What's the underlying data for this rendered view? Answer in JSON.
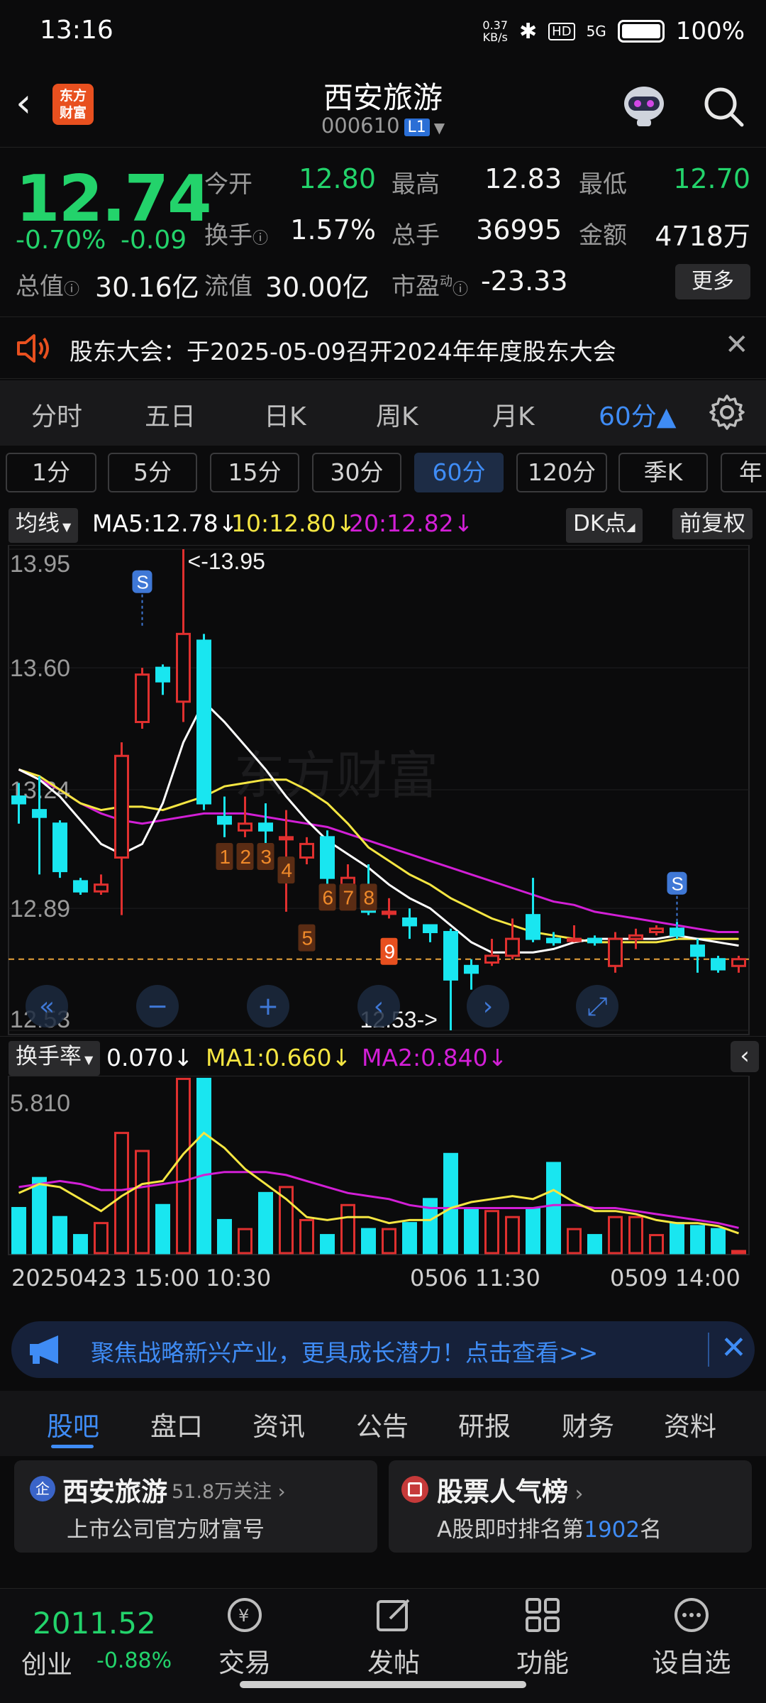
{
  "status_bar": {
    "time": "13:16",
    "net_speed_top": "0.37",
    "net_speed_bottom": "KB/s",
    "signal_label": "5G",
    "hd_label": "HD",
    "battery": "100%"
  },
  "header": {
    "app_logo_line1": "东方",
    "app_logo_line2": "财富",
    "title": "西安旅游",
    "code": "000610",
    "level": "L1"
  },
  "quote": {
    "price": "12.74",
    "pct_change": "-0.70%",
    "abs_change": "-0.09",
    "open_label": "今开",
    "open": "12.80",
    "high_label": "最高",
    "high": "12.83",
    "low_label": "最低",
    "low": "12.70",
    "turnover_label": "换手",
    "turnover": "1.57%",
    "volume_label": "总手",
    "volume": "36995",
    "amount_label": "金额",
    "amount": "4718万",
    "mktcap_label": "总值",
    "mktcap": "30.16亿",
    "float_label": "流值",
    "float_cap": "30.00亿",
    "pe_label": "市盈",
    "pe_sup": "动",
    "pe": "-23.33",
    "more": "更多"
  },
  "notice": {
    "text": "股东大会：于2025-05-09召开2024年年度股东大会"
  },
  "period_tabs": [
    {
      "label": "分时",
      "active": false
    },
    {
      "label": "五日",
      "active": false
    },
    {
      "label": "日K",
      "active": false
    },
    {
      "label": "周K",
      "active": false
    },
    {
      "label": "月K",
      "active": false
    },
    {
      "label": "60分▲",
      "active": true
    }
  ],
  "sub_periods": [
    {
      "label": "1分",
      "active": false
    },
    {
      "label": "5分",
      "active": false
    },
    {
      "label": "15分",
      "active": false
    },
    {
      "label": "30分",
      "active": false
    },
    {
      "label": "60分",
      "active": true
    },
    {
      "label": "120分",
      "active": false
    },
    {
      "label": "季K",
      "active": false
    },
    {
      "label": "年",
      "active": false
    }
  ],
  "ma_row": {
    "selector": "均线",
    "ma5": "MA5:12.78↓",
    "ma10": "10:12.80↓",
    "ma20": "20:12.82↓",
    "dk": "DK点",
    "adjust": "前复权"
  },
  "kline": {
    "y_labels": [
      "13.95",
      "13.60",
      "13.24",
      "12.89",
      "12.53"
    ],
    "high_marker": "<-13.95",
    "low_marker": "12.53->",
    "signal_s": "S",
    "watermark": "东方财富",
    "td_counts": [
      "1",
      "2",
      "3",
      "4",
      "5",
      "6",
      "7",
      "8",
      "9"
    ],
    "colors": {
      "up": "#e0302f",
      "down": "#19e6f0",
      "ma5": "#ffffff",
      "ma10": "#f5e642",
      "ma20": "#d21fd6"
    }
  },
  "chart_data": [
    {
      "type": "candlestick",
      "title": "",
      "ylim": [
        12.53,
        13.95
      ],
      "candles": [
        {
          "o": 13.22,
          "c": 13.2,
          "h": 13.26,
          "l": 13.14
        },
        {
          "o": 13.18,
          "c": 13.16,
          "h": 13.28,
          "l": 12.99
        },
        {
          "o": 13.14,
          "c": 13.0,
          "h": 13.15,
          "l": 12.98
        },
        {
          "o": 12.97,
          "c": 12.94,
          "h": 12.98,
          "l": 12.93
        },
        {
          "o": 12.94,
          "c": 12.96,
          "h": 12.99,
          "l": 12.93
        },
        {
          "o": 13.04,
          "c": 13.34,
          "h": 13.38,
          "l": 12.87
        },
        {
          "o": 13.44,
          "c": 13.58,
          "h": 13.6,
          "l": 13.42
        },
        {
          "o": 13.6,
          "c": 13.56,
          "h": 13.61,
          "l": 13.52
        },
        {
          "o": 13.5,
          "c": 13.7,
          "h": 13.95,
          "l": 13.44
        },
        {
          "o": 13.68,
          "c": 13.2,
          "h": 13.7,
          "l": 13.18
        },
        {
          "o": 13.16,
          "c": 13.14,
          "h": 13.22,
          "l": 13.1
        },
        {
          "o": 13.12,
          "c": 13.14,
          "h": 13.22,
          "l": 13.1
        },
        {
          "o": 13.14,
          "c": 13.12,
          "h": 13.2,
          "l": 13.08
        },
        {
          "o": 13.1,
          "c": 13.1,
          "h": 13.18,
          "l": 12.88
        },
        {
          "o": 13.04,
          "c": 13.08,
          "h": 13.1,
          "l": 13.02
        },
        {
          "o": 13.1,
          "c": 12.98,
          "h": 13.12,
          "l": 12.96
        },
        {
          "o": 12.96,
          "c": 12.98,
          "h": 13.02,
          "l": 12.92
        },
        {
          "o": 12.9,
          "c": 12.88,
          "h": 13.02,
          "l": 12.87
        },
        {
          "o": 12.88,
          "c": 12.88,
          "h": 12.92,
          "l": 12.86
        },
        {
          "o": 12.86,
          "c": 12.84,
          "h": 12.89,
          "l": 12.8
        },
        {
          "o": 12.84,
          "c": 12.82,
          "h": 12.84,
          "l": 12.79
        },
        {
          "o": 12.82,
          "c": 12.68,
          "h": 12.83,
          "l": 12.53
        },
        {
          "o": 12.72,
          "c": 12.7,
          "h": 12.74,
          "l": 12.65
        },
        {
          "o": 12.73,
          "c": 12.75,
          "h": 12.8,
          "l": 12.72
        },
        {
          "o": 12.75,
          "c": 12.8,
          "h": 12.86,
          "l": 12.74
        },
        {
          "o": 12.87,
          "c": 12.8,
          "h": 12.98,
          "l": 12.79
        },
        {
          "o": 12.8,
          "c": 12.79,
          "h": 12.82,
          "l": 12.78
        },
        {
          "o": 12.8,
          "c": 12.8,
          "h": 12.84,
          "l": 12.79
        },
        {
          "o": 12.8,
          "c": 12.79,
          "h": 12.81,
          "l": 12.78
        },
        {
          "o": 12.72,
          "c": 12.8,
          "h": 12.82,
          "l": 12.7
        },
        {
          "o": 12.8,
          "c": 12.81,
          "h": 12.83,
          "l": 12.77
        },
        {
          "o": 12.82,
          "c": 12.83,
          "h": 12.84,
          "l": 12.81
        },
        {
          "o": 12.83,
          "c": 12.81,
          "h": 12.85,
          "l": 12.8
        },
        {
          "o": 12.78,
          "c": 12.75,
          "h": 12.8,
          "l": 12.7
        },
        {
          "o": 12.74,
          "c": 12.71,
          "h": 12.75,
          "l": 12.7
        },
        {
          "o": 12.72,
          "c": 12.74,
          "h": 12.75,
          "l": 12.7
        }
      ],
      "ma5": [
        13.3,
        13.27,
        13.22,
        13.15,
        13.08,
        13.05,
        13.08,
        13.2,
        13.38,
        13.5,
        13.44,
        13.37,
        13.3,
        13.22,
        13.15,
        13.09,
        13.05,
        13.01,
        12.96,
        12.92,
        12.89,
        12.84,
        12.79,
        12.76,
        12.76,
        12.76,
        12.77,
        12.79,
        12.8,
        12.8,
        12.8,
        12.8,
        12.81,
        12.8,
        12.79,
        12.78
      ],
      "ma10": [
        13.3,
        13.28,
        13.24,
        13.2,
        13.18,
        13.19,
        13.19,
        13.18,
        13.2,
        13.22,
        13.25,
        13.26,
        13.27,
        13.27,
        13.24,
        13.2,
        13.14,
        13.07,
        13.03,
        12.99,
        12.96,
        12.92,
        12.89,
        12.86,
        12.84,
        12.82,
        12.81,
        12.8,
        12.79,
        12.79,
        12.79,
        12.79,
        12.8,
        12.8,
        12.8,
        12.8
      ],
      "ma20": [
        13.3,
        13.27,
        13.24,
        13.2,
        13.17,
        13.15,
        13.14,
        13.15,
        13.16,
        13.17,
        13.17,
        13.17,
        13.16,
        13.15,
        13.14,
        13.13,
        13.11,
        13.09,
        13.07,
        13.05,
        13.03,
        13.01,
        12.99,
        12.97,
        12.95,
        12.93,
        12.91,
        12.9,
        12.88,
        12.87,
        12.86,
        12.85,
        12.84,
        12.83,
        12.82,
        12.82
      ]
    },
    {
      "type": "bar",
      "title": "换手率",
      "ylim": [
        0,
        5.81
      ],
      "values": [
        1.5,
        2.5,
        1.2,
        0.6,
        1.0,
        4.0,
        3.4,
        1.6,
        5.8,
        5.8,
        1.1,
        0.8,
        2.0,
        2.2,
        1.1,
        0.6,
        1.6,
        0.8,
        0.8,
        1.0,
        1.8,
        3.3,
        1.5,
        1.4,
        1.2,
        1.5,
        3.0,
        0.8,
        0.6,
        1.2,
        1.2,
        0.6,
        1.0,
        0.9,
        0.8,
        0.07
      ],
      "ma1": [
        2.0,
        2.3,
        2.2,
        1.8,
        1.4,
        1.9,
        2.3,
        2.4,
        3.3,
        4.0,
        3.5,
        2.8,
        2.3,
        1.8,
        1.2,
        1.1,
        1.2,
        1.2,
        1.0,
        1.1,
        1.1,
        1.5,
        1.7,
        1.8,
        1.9,
        1.8,
        2.1,
        1.7,
        1.4,
        1.4,
        1.3,
        1.1,
        1.0,
        1.0,
        0.9,
        0.66
      ],
      "ma2": [
        2.2,
        2.3,
        2.4,
        2.3,
        2.1,
        2.1,
        2.2,
        2.3,
        2.4,
        2.6,
        2.7,
        2.7,
        2.7,
        2.6,
        2.4,
        2.2,
        2.0,
        1.9,
        1.8,
        1.6,
        1.5,
        1.5,
        1.5,
        1.5,
        1.5,
        1.5,
        1.6,
        1.6,
        1.5,
        1.5,
        1.4,
        1.3,
        1.2,
        1.1,
        1.0,
        0.84
      ],
      "y_label_top": "5.810"
    }
  ],
  "vol_row": {
    "selector": "换手率",
    "value": "0.070↓",
    "ma1": "MA1:0.660↓",
    "ma2": "MA2:0.840↓"
  },
  "time_axis": {
    "start": "20250423 15:00",
    "t2": "10:30",
    "t3": "0506 11:30",
    "t4": "0509 14:00"
  },
  "promo": {
    "text": "聚焦战略新兴产业，更具成长潜力！点击查看>>"
  },
  "content_tabs": [
    "股吧",
    "盘口",
    "资讯",
    "公告",
    "研报",
    "财务",
    "资料"
  ],
  "cards": {
    "left_title": "西安旅游",
    "left_follow": "51.8万关注",
    "left_sub": "上市公司官方财富号",
    "right_title": "股票人气榜",
    "right_sub_prefix": "A股即时排名第",
    "right_rank": "1902",
    "right_sub_suffix": "名"
  },
  "bottom_nav": {
    "index_value": "2011.52",
    "index_name": "创业",
    "index_change": "-0.88%",
    "items": [
      "交易",
      "发帖",
      "功能",
      "设自选"
    ]
  }
}
